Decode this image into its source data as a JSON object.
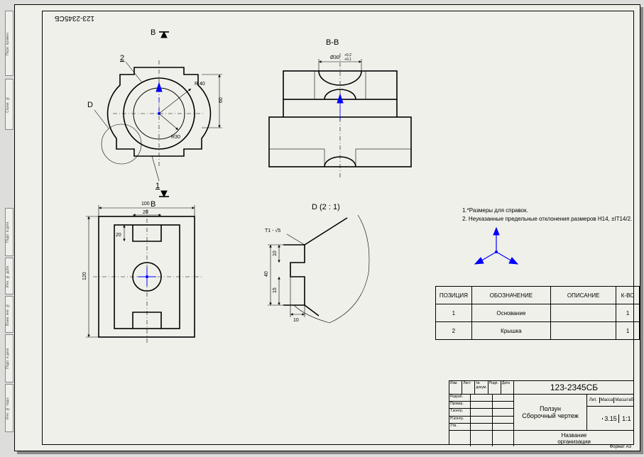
{
  "sheet_code": "123-2345СБ",
  "section_label_top": "B-B",
  "section_label_detail": "D (2 : 1)",
  "section_cut_letter": "B",
  "detail_circle_letter": "D",
  "balloon_1": "1",
  "balloon_2": "2",
  "dims": {
    "r40": "R 40",
    "r30": "R30",
    "d30": "Ø30",
    "d30_tol_hi": "+0,2",
    "d30_tol_lo": "+0,1",
    "h60": "60",
    "w100": "100",
    "w20": "20",
    "w20b": "20",
    "h120": "120",
    "dv40": "40",
    "dv10": "10",
    "dv15": "15",
    "dh10": "10",
    "surf": "T1 - √5"
  },
  "notes": {
    "l1": "1.*Размеры для справок.",
    "l2": "2. Неуказанные предельные отклонения размеров H14, ±IT14/2."
  },
  "bom": {
    "headers": {
      "pos": "ПОЗИЦИЯ",
      "des": "ОБОЗНАЧЕНИЕ",
      "desc": "ОПИСАНИЕ",
      "qty": "К-ВО"
    },
    "rows": [
      {
        "pos": "1",
        "des": "Основание",
        "desc": "",
        "qty": "1"
      },
      {
        "pos": "2",
        "des": "Крышка",
        "desc": "",
        "qty": "1"
      }
    ]
  },
  "titleblock": {
    "code": "123-2345СБ",
    "name1": "Ползун",
    "name2": "Сборочный чертеж",
    "mass": "3.15",
    "scale": "1:1",
    "hdr_mass": "Масса",
    "hdr_scale": "Масштаб",
    "hdr_lit": "Лит.",
    "org1": "Название",
    "org2": "организации",
    "format": "Формат А3",
    "g_izm": "Изм.",
    "g_list": "Лист",
    "g_doc": "№ докум.",
    "g_podp": "Подп.",
    "g_data": "Дата",
    "g_razr": "Разраб.",
    "g_prov": "Провер.",
    "g_tkon": "Т.контр.",
    "g_nkon": "Н.контр.",
    "g_utv": "Утв."
  },
  "tabs": [
    "Перв. примен.",
    "Справ. №",
    "Подп. и дата",
    "Инв. № дубл.",
    "Взам. инв. №",
    "Подп. и дата",
    "Инв. № подл."
  ]
}
